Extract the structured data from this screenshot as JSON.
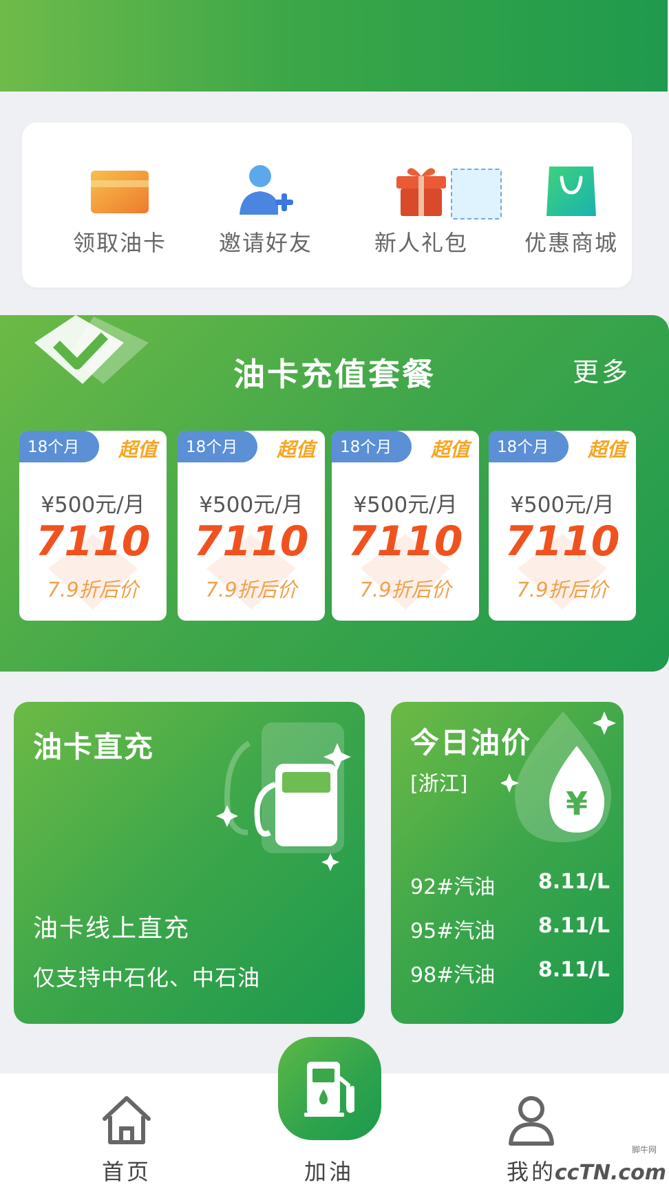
{
  "quick_actions": [
    {
      "label": "领取油卡",
      "icon": "card-icon"
    },
    {
      "label": "邀请好友",
      "icon": "invite-user-icon"
    },
    {
      "label": "新人礼包",
      "icon": "gift-icon"
    },
    {
      "label": "优惠商城",
      "icon": "shopping-bag-icon"
    }
  ],
  "packages": {
    "title": "油卡充值套餐",
    "more": "更多",
    "cards": [
      {
        "tag": "18个月",
        "badge": "超值",
        "price": "¥500元/月",
        "total": "7110",
        "discount": "7.9折后价"
      },
      {
        "tag": "18个月",
        "badge": "超值",
        "price": "¥500元/月",
        "total": "7110",
        "discount": "7.9折后价"
      },
      {
        "tag": "18个月",
        "badge": "超值",
        "price": "¥500元/月",
        "total": "7110",
        "discount": "7.9折后价"
      },
      {
        "tag": "18个月",
        "badge": "超值",
        "price": "¥500元/月",
        "total": "7110",
        "discount": "7.9折后价"
      }
    ]
  },
  "direct_recharge": {
    "title": "油卡直充",
    "subtitle": "油卡线上直充",
    "note": "仅支持中石化、中石油"
  },
  "oil_price": {
    "title": "今日油价",
    "region": "[浙江]",
    "rows": [
      {
        "name": "92#汽油",
        "value": "8.11/L"
      },
      {
        "name": "95#汽油",
        "value": "8.11/L"
      },
      {
        "name": "98#汽油",
        "value": "8.11/L"
      }
    ]
  },
  "nav": {
    "home": "首页",
    "refuel": "加油",
    "mine": "我的"
  },
  "watermark": {
    "small": "脚牛网",
    "big": "ccTN.com"
  },
  "colors": {
    "brand_green": "#2ea34c",
    "price_red": "#f0521f",
    "badge_gold": "#f5a623",
    "tag_blue": "#5b8fd6"
  }
}
